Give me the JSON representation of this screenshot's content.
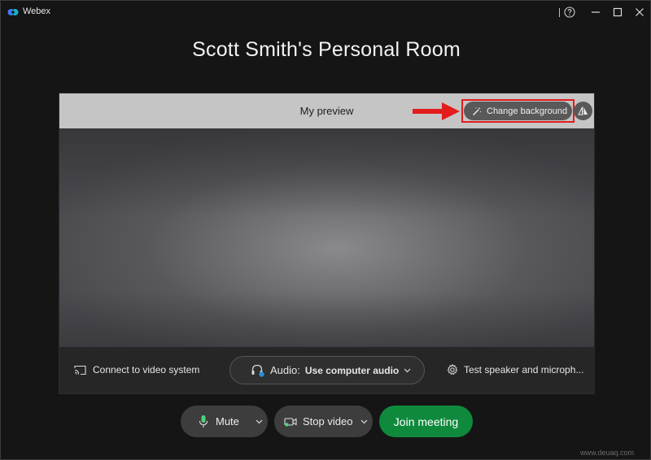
{
  "window": {
    "app_name": "Webex"
  },
  "room": {
    "title": "Scott Smith's Personal Room"
  },
  "preview": {
    "label": "My preview",
    "change_background_label": "Change background"
  },
  "footer": {
    "connect_label": "Connect to video system",
    "audio_prefix": "Audio:",
    "audio_value": "Use computer audio",
    "test_label": "Test speaker and microph..."
  },
  "controls": {
    "mute_label": "Mute",
    "stop_video_label": "Stop video",
    "join_label": "Join meeting"
  },
  "watermark": "www.deuaq.com",
  "colors": {
    "join_green": "#0f8a3d",
    "highlight_red": "#e31c1c",
    "background": "#151515"
  }
}
